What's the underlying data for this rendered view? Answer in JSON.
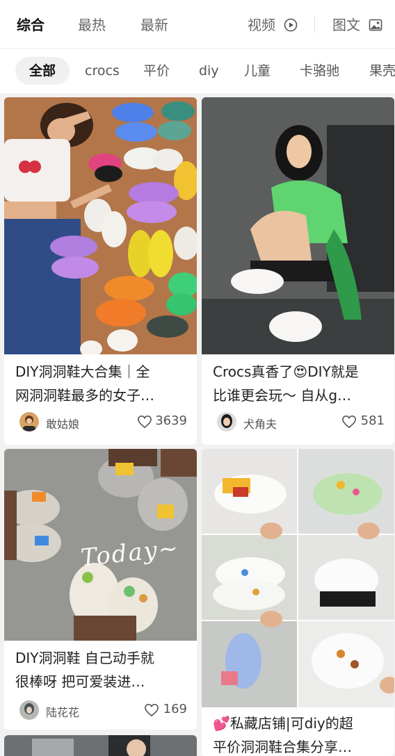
{
  "top_tabs": {
    "comprehensive": "综合",
    "hottest": "最热",
    "newest": "最新",
    "video": "视频",
    "image_text": "图文"
  },
  "chips": [
    "全部",
    "crocs",
    "平价",
    "diy",
    "儿童",
    "卡骆驰",
    "果壳"
  ],
  "posts": [
    {
      "title_line1": "DIY洞洞鞋大合集｜全",
      "title_line2": "网洞洞鞋最多的女子…",
      "author": "敢姑娘",
      "likes": "3639"
    },
    {
      "title_line1": "Crocs真香了😍DIY就是",
      "title_line2": "比谁更会玩～ 自从g…",
      "author": "犬角夫",
      "likes": "581"
    },
    {
      "title_line1": "DIY洞洞鞋 自己动手就",
      "title_line2": "很棒呀 把可爱装进…",
      "author": "陆花花",
      "likes": "169"
    },
    {
      "title_line1": "💕私藏店铺|可diy的超",
      "title_line2": "平价洞洞鞋合集分享…"
    }
  ],
  "image_overlay_text": "Today~",
  "icons": {
    "video": "play-circle-icon",
    "image_text": "image-icon",
    "like": "heart-icon"
  },
  "colors": {
    "active_text": "#111111",
    "inactive_text": "#666666",
    "background": "#f2f2f2"
  }
}
